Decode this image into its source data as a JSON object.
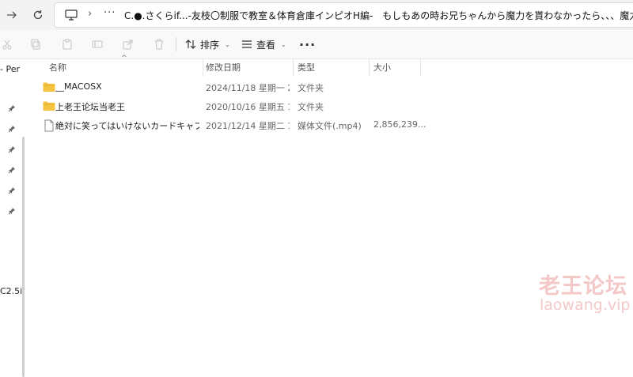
{
  "address_bar": {
    "more_glyph": "···",
    "path": "C.●.さくらif...-友枝〇制服で教室＆体育倉庫インピオH編-　もしもあの時お兄ちゃんから魔力を貰わなかったら、、、魔力補充"
  },
  "toolbar": {
    "sort_label": "排序",
    "view_label": "查看",
    "more_glyph": "···"
  },
  "sidebar": {
    "partial_top_label": "- Per",
    "partial_bottom_label": "C2.5i",
    "pinned_count": 6
  },
  "columns": {
    "name": "名称",
    "modified": "修改日期",
    "type": "类型",
    "size": "大小"
  },
  "files": [
    {
      "icon": "folder-icon",
      "name": "__MACOSX",
      "modified": "2024/11/18 星期一 2...",
      "type": "文件夹",
      "size": ""
    },
    {
      "icon": "folder-icon",
      "name": "上老王论坛当老王",
      "modified": "2020/10/16 星期五 1...",
      "type": "文件夹",
      "size": ""
    },
    {
      "icon": "file-icon",
      "name": "絶対に笑ってはいけないカードキャプタ...",
      "modified": "2021/12/14 星期二 1...",
      "type": "媒体文件(.mp4)",
      "size": "2,856,239..."
    }
  ],
  "watermark": {
    "title": "老王论坛",
    "subtitle": "laowang.vip"
  },
  "colors": {
    "folder": "#f4c542",
    "accent": "#0067c0",
    "watermark": "#f5c8c8"
  }
}
